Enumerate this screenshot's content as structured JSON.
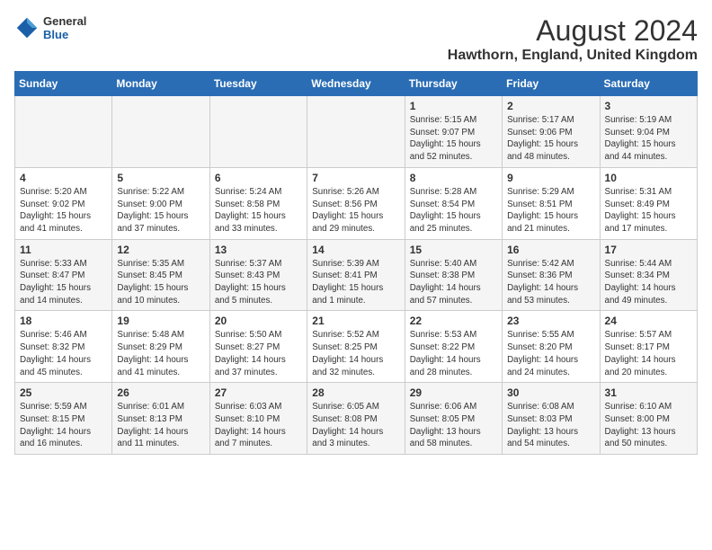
{
  "logo": {
    "general": "General",
    "blue": "Blue"
  },
  "title": "August 2024",
  "subtitle": "Hawthorn, England, United Kingdom",
  "days_of_week": [
    "Sunday",
    "Monday",
    "Tuesday",
    "Wednesday",
    "Thursday",
    "Friday",
    "Saturday"
  ],
  "weeks": [
    [
      {
        "day": "",
        "info": ""
      },
      {
        "day": "",
        "info": ""
      },
      {
        "day": "",
        "info": ""
      },
      {
        "day": "",
        "info": ""
      },
      {
        "day": "1",
        "info": "Sunrise: 5:15 AM\nSunset: 9:07 PM\nDaylight: 15 hours\nand 52 minutes."
      },
      {
        "day": "2",
        "info": "Sunrise: 5:17 AM\nSunset: 9:06 PM\nDaylight: 15 hours\nand 48 minutes."
      },
      {
        "day": "3",
        "info": "Sunrise: 5:19 AM\nSunset: 9:04 PM\nDaylight: 15 hours\nand 44 minutes."
      }
    ],
    [
      {
        "day": "4",
        "info": "Sunrise: 5:20 AM\nSunset: 9:02 PM\nDaylight: 15 hours\nand 41 minutes."
      },
      {
        "day": "5",
        "info": "Sunrise: 5:22 AM\nSunset: 9:00 PM\nDaylight: 15 hours\nand 37 minutes."
      },
      {
        "day": "6",
        "info": "Sunrise: 5:24 AM\nSunset: 8:58 PM\nDaylight: 15 hours\nand 33 minutes."
      },
      {
        "day": "7",
        "info": "Sunrise: 5:26 AM\nSunset: 8:56 PM\nDaylight: 15 hours\nand 29 minutes."
      },
      {
        "day": "8",
        "info": "Sunrise: 5:28 AM\nSunset: 8:54 PM\nDaylight: 15 hours\nand 25 minutes."
      },
      {
        "day": "9",
        "info": "Sunrise: 5:29 AM\nSunset: 8:51 PM\nDaylight: 15 hours\nand 21 minutes."
      },
      {
        "day": "10",
        "info": "Sunrise: 5:31 AM\nSunset: 8:49 PM\nDaylight: 15 hours\nand 17 minutes."
      }
    ],
    [
      {
        "day": "11",
        "info": "Sunrise: 5:33 AM\nSunset: 8:47 PM\nDaylight: 15 hours\nand 14 minutes."
      },
      {
        "day": "12",
        "info": "Sunrise: 5:35 AM\nSunset: 8:45 PM\nDaylight: 15 hours\nand 10 minutes."
      },
      {
        "day": "13",
        "info": "Sunrise: 5:37 AM\nSunset: 8:43 PM\nDaylight: 15 hours\nand 5 minutes."
      },
      {
        "day": "14",
        "info": "Sunrise: 5:39 AM\nSunset: 8:41 PM\nDaylight: 15 hours\nand 1 minute."
      },
      {
        "day": "15",
        "info": "Sunrise: 5:40 AM\nSunset: 8:38 PM\nDaylight: 14 hours\nand 57 minutes."
      },
      {
        "day": "16",
        "info": "Sunrise: 5:42 AM\nSunset: 8:36 PM\nDaylight: 14 hours\nand 53 minutes."
      },
      {
        "day": "17",
        "info": "Sunrise: 5:44 AM\nSunset: 8:34 PM\nDaylight: 14 hours\nand 49 minutes."
      }
    ],
    [
      {
        "day": "18",
        "info": "Sunrise: 5:46 AM\nSunset: 8:32 PM\nDaylight: 14 hours\nand 45 minutes."
      },
      {
        "day": "19",
        "info": "Sunrise: 5:48 AM\nSunset: 8:29 PM\nDaylight: 14 hours\nand 41 minutes."
      },
      {
        "day": "20",
        "info": "Sunrise: 5:50 AM\nSunset: 8:27 PM\nDaylight: 14 hours\nand 37 minutes."
      },
      {
        "day": "21",
        "info": "Sunrise: 5:52 AM\nSunset: 8:25 PM\nDaylight: 14 hours\nand 32 minutes."
      },
      {
        "day": "22",
        "info": "Sunrise: 5:53 AM\nSunset: 8:22 PM\nDaylight: 14 hours\nand 28 minutes."
      },
      {
        "day": "23",
        "info": "Sunrise: 5:55 AM\nSunset: 8:20 PM\nDaylight: 14 hours\nand 24 minutes."
      },
      {
        "day": "24",
        "info": "Sunrise: 5:57 AM\nSunset: 8:17 PM\nDaylight: 14 hours\nand 20 minutes."
      }
    ],
    [
      {
        "day": "25",
        "info": "Sunrise: 5:59 AM\nSunset: 8:15 PM\nDaylight: 14 hours\nand 16 minutes."
      },
      {
        "day": "26",
        "info": "Sunrise: 6:01 AM\nSunset: 8:13 PM\nDaylight: 14 hours\nand 11 minutes."
      },
      {
        "day": "27",
        "info": "Sunrise: 6:03 AM\nSunset: 8:10 PM\nDaylight: 14 hours\nand 7 minutes."
      },
      {
        "day": "28",
        "info": "Sunrise: 6:05 AM\nSunset: 8:08 PM\nDaylight: 14 hours\nand 3 minutes."
      },
      {
        "day": "29",
        "info": "Sunrise: 6:06 AM\nSunset: 8:05 PM\nDaylight: 13 hours\nand 58 minutes."
      },
      {
        "day": "30",
        "info": "Sunrise: 6:08 AM\nSunset: 8:03 PM\nDaylight: 13 hours\nand 54 minutes."
      },
      {
        "day": "31",
        "info": "Sunrise: 6:10 AM\nSunset: 8:00 PM\nDaylight: 13 hours\nand 50 minutes."
      }
    ]
  ]
}
